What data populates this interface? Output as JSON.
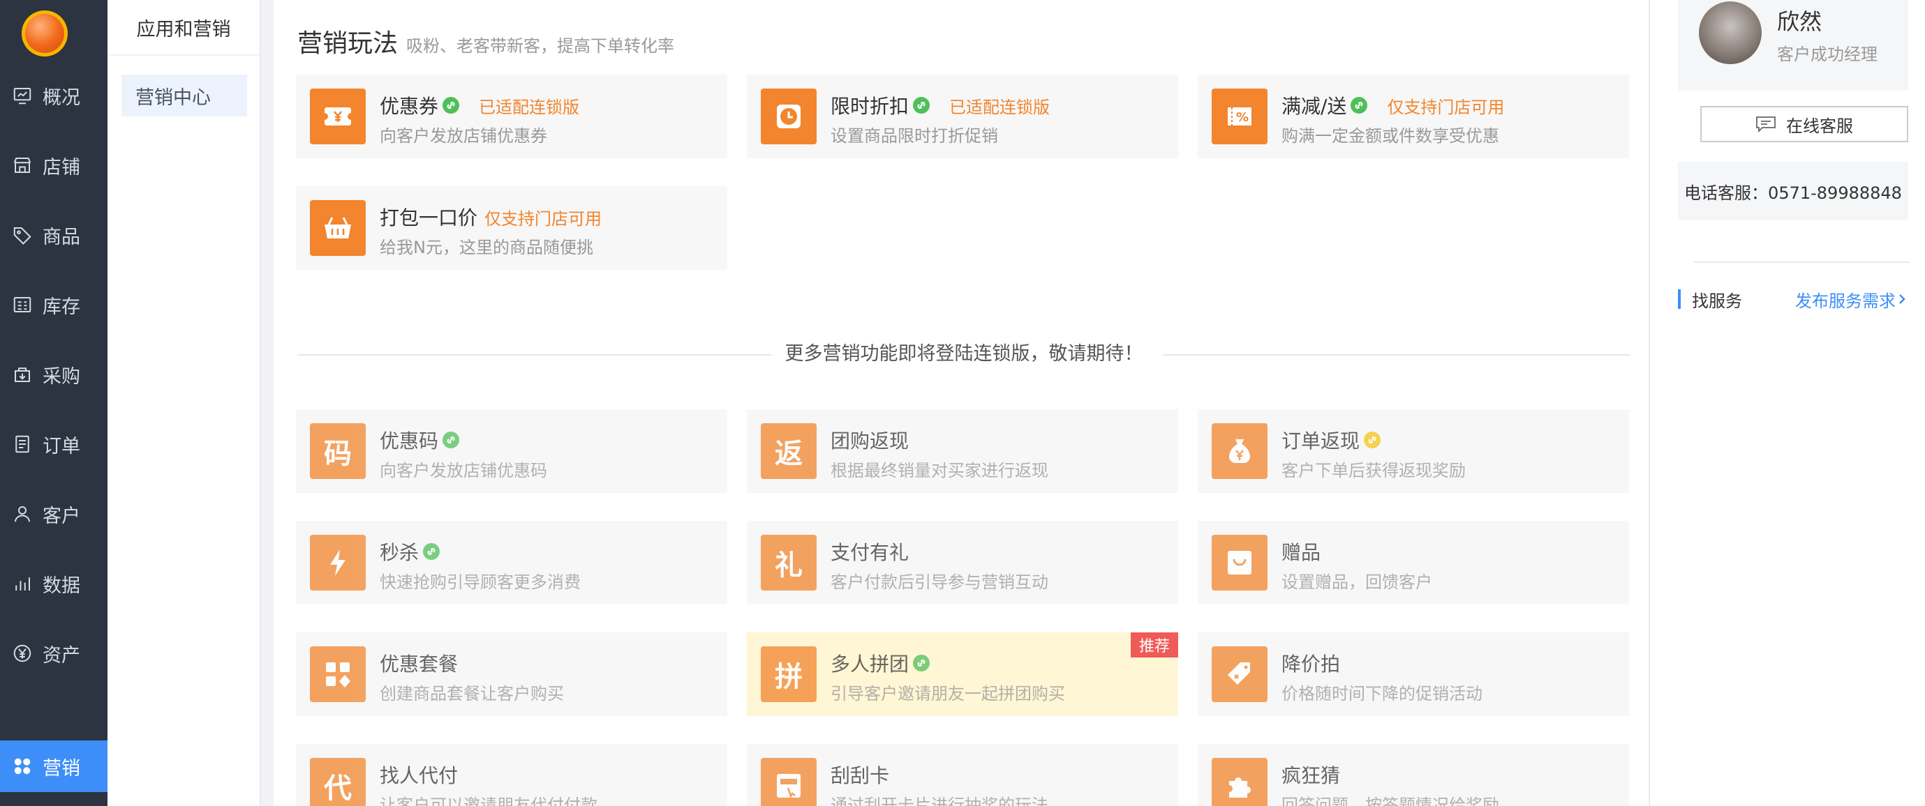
{
  "nav": {
    "items": [
      {
        "label": "概况",
        "icon": "overview-icon"
      },
      {
        "label": "店铺",
        "icon": "store-icon"
      },
      {
        "label": "商品",
        "icon": "tag-icon"
      },
      {
        "label": "库存",
        "icon": "inventory-icon"
      },
      {
        "label": "采购",
        "icon": "purchase-icon"
      },
      {
        "label": "订单",
        "icon": "order-icon"
      },
      {
        "label": "客户",
        "icon": "customer-icon"
      },
      {
        "label": "数据",
        "icon": "chart-icon"
      },
      {
        "label": "资产",
        "icon": "yen-icon"
      },
      {
        "label": "营销",
        "icon": "grid-icon",
        "active": true
      }
    ]
  },
  "sub": {
    "title": "应用和营销",
    "menu": "营销中心"
  },
  "main": {
    "title": "营销玩法",
    "subtitle": "吸粉、老客带新客，提高下单转化率",
    "divider": "更多营销功能即将登陆连锁版，敬请期待！",
    "cards": [
      {
        "title": "优惠券",
        "desc": "向客户发放店铺优惠券",
        "tag": "已适配连锁版",
        "link": "green",
        "icon": "coupon-icon"
      },
      {
        "title": "限时折扣",
        "desc": "设置商品限时打折促销",
        "tag": "已适配连锁版",
        "link": "green",
        "icon": "clock-icon"
      },
      {
        "title": "满减/送",
        "desc": "购满一定金额或件数享受优惠",
        "tag": "仅支持门店可用",
        "link": "green",
        "icon": "percent-icon"
      },
      {
        "title": "打包一口价",
        "desc": "给我N元，这里的商品随便挑",
        "tag": "仅支持门店可用",
        "icon": "basket-icon"
      },
      {
        "title": "优惠码",
        "desc": "向客户发放店铺优惠码",
        "link": "green",
        "glyph": "码"
      },
      {
        "title": "团购返现",
        "desc": "根据最终销量对买家进行返现",
        "glyph": "返"
      },
      {
        "title": "订单返现",
        "desc": "客户下单后获得返现奖励",
        "link": "yellow",
        "icon": "moneybag-icon"
      },
      {
        "title": "秒杀",
        "desc": "快速抢购引导顾客更多消费",
        "link": "green",
        "icon": "lightning-icon"
      },
      {
        "title": "支付有礼",
        "desc": "客户付款后引导参与营销互动",
        "glyph": "礼"
      },
      {
        "title": "赠品",
        "desc": "设置赠品，回馈客户",
        "icon": "bag-icon"
      },
      {
        "title": "优惠套餐",
        "desc": "创建商品套餐让客户购买",
        "icon": "blocks-icon"
      },
      {
        "title": "多人拼团",
        "desc": "引导客户邀请朋友一起拼团购买",
        "link": "green",
        "glyph": "拼",
        "badge": "推荐"
      },
      {
        "title": "降价拍",
        "desc": "价格随时间下降的促销活动",
        "icon": "pricetag-icon"
      },
      {
        "title": "找人代付",
        "desc": "让客户可以邀请朋友代付付款",
        "glyph": "代"
      },
      {
        "title": "刮刮卡",
        "desc": "通过刮开卡片进行抽奖的玩法",
        "icon": "scratch-icon"
      },
      {
        "title": "疯狂猜",
        "desc": "回答问题，按答题情况给奖励",
        "icon": "puzzle-icon"
      }
    ]
  },
  "right": {
    "name": "欣然",
    "role": "客户成功经理",
    "online": "在线客服",
    "phone": "电话客服：0571-89988848",
    "find": "找服务",
    "publish": "发布服务需求"
  },
  "colors": {
    "accent": "#3d8ef8",
    "icon_bg": "#f2852d",
    "nav_bg": "#2b3440",
    "badge": "#ef5b57"
  }
}
